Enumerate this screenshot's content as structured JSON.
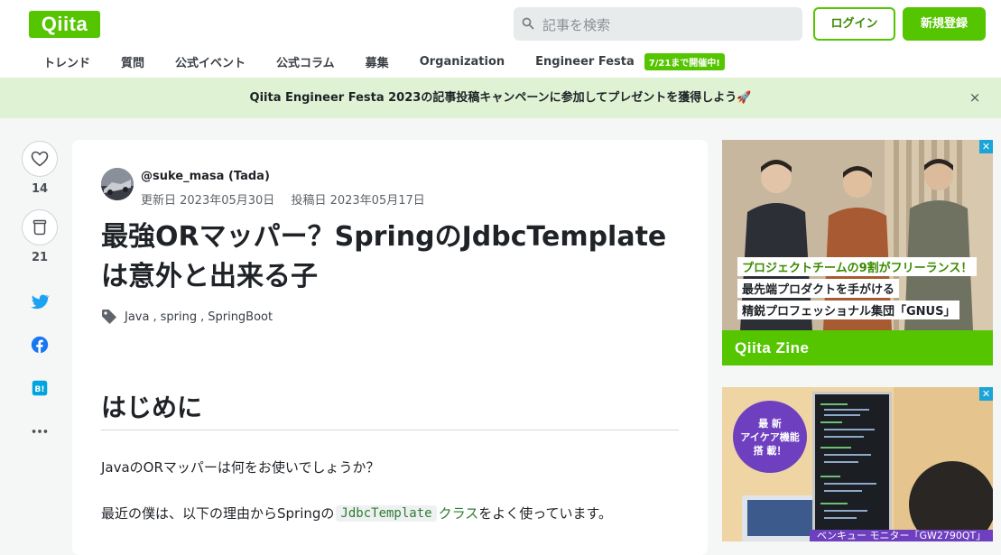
{
  "header": {
    "logo": "Qiita",
    "search_placeholder": "記事を検索",
    "login": "ログイン",
    "signup": "新規登録"
  },
  "nav": {
    "items": [
      "トレンド",
      "質問",
      "公式イベント",
      "公式コラム",
      "募集",
      "Organization",
      "Engineer Festa"
    ],
    "badge": "7/21まで開催中!"
  },
  "banner": {
    "text": "Qiita Engineer Festa 2023の記事投稿キャンペーンに参加してプレゼントを獲得しよう🚀",
    "close": "×"
  },
  "side": {
    "likes": "14",
    "stocks": "21"
  },
  "article": {
    "author": "@suke_masa (Tada)",
    "updated": "更新日 2023年05月30日",
    "posted": "投稿日 2023年05月17日",
    "title": "最強ORマッパー？SpringのJdbcTemplateは意外と出来る子",
    "tags": [
      "Java",
      "spring",
      "SpringBoot"
    ],
    "heading": "はじめに",
    "para1": "JavaのORマッパーは何をお使いでしょうか？",
    "para2_before": "最近の僕は、以下の理由からSpringの",
    "para2_code": "JdbcTemplate",
    "para2_link": "クラス",
    "para2_after": "をよく使っています。"
  },
  "ads": {
    "ad1": {
      "line1": "プロジェクトチームの9割がフリーランス！",
      "line2": "最先端プロダクトを手がける",
      "line3": "精鋭プロフェッショナル集団「GNUS」",
      "footer": "Qiita Zine"
    },
    "ad2": {
      "bubble1": "最 新",
      "bubble2": "アイケア機能",
      "bubble3": "搭 載！",
      "strip": "ベンキュー モニター「GW2790QT」"
    }
  }
}
